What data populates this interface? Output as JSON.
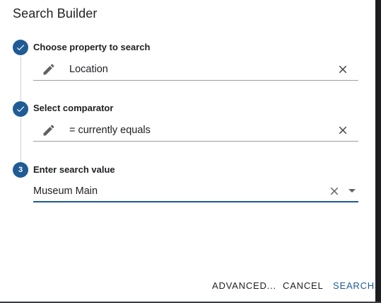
{
  "dialog": {
    "title": "Search Builder"
  },
  "steps": [
    {
      "state": "completed",
      "label": "Choose property to search",
      "value": "Location"
    },
    {
      "state": "completed",
      "label": "Select comparator",
      "value": "= currently equals"
    },
    {
      "state": "active",
      "number": "3",
      "label": "Enter search value",
      "value": "Museum Main"
    }
  ],
  "actions": {
    "advanced_label": "ADVANCED...",
    "cancel_label": "CANCEL",
    "search_label": "SEARCH"
  },
  "colors": {
    "accent": "#1f5b94",
    "text": "#202124",
    "icon": "#616161"
  }
}
